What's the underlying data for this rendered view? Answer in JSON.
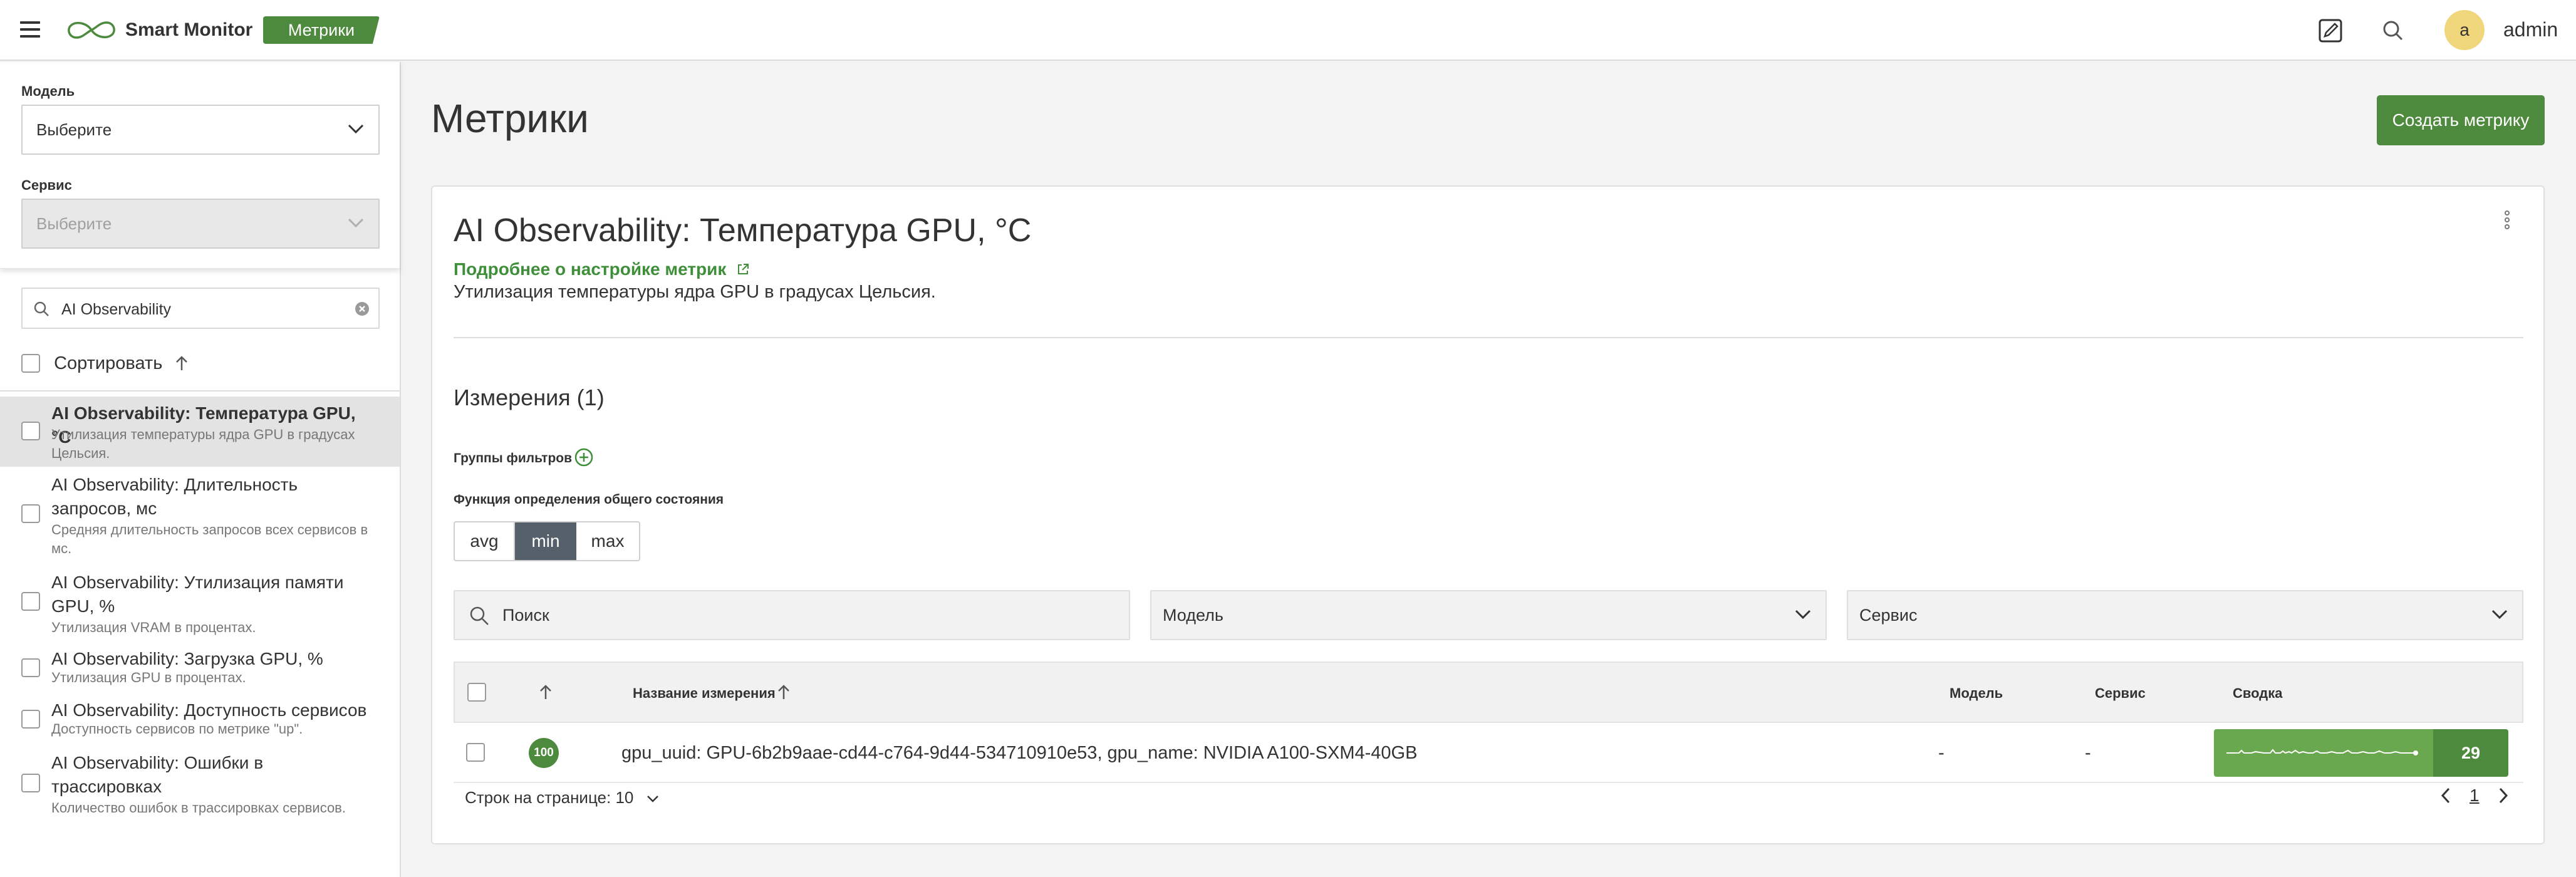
{
  "topbar": {
    "app_name": "Smart Monitor",
    "section": "Метрики",
    "avatar_letter": "a",
    "username": "admin"
  },
  "sidebar": {
    "model_label": "Модель",
    "model_value": "Выберите",
    "service_label": "Сервис",
    "service_value": "Выберите",
    "search_value": "AI Observability",
    "sort_label": "Сортировать",
    "items": [
      {
        "title": "AI Observability: Температура GPU, °C",
        "desc": "Утилизация температуры ядра GPU в градусах Цельсия."
      },
      {
        "title": "AI Observability: Длительность запросов, мс",
        "desc": "Средняя длительность запросов всех сервисов в мс."
      },
      {
        "title": "AI Observability: Утилизация памяти GPU, %",
        "desc": "Утилизация VRAM в процентах."
      },
      {
        "title": "AI Observability: Загрузка GPU, %",
        "desc": "Утилизация GPU в процентах."
      },
      {
        "title": "AI Observability: Доступность сервисов",
        "desc": "Доступность сервисов по метрике \"up\"."
      },
      {
        "title": "AI Observability: Ошибки в трассировках",
        "desc": "Количество ошибок в трассировках сервисов."
      }
    ]
  },
  "main": {
    "page_title": "Метрики",
    "create_button": "Создать метрику",
    "card": {
      "title": "AI Observability: Температура GPU, °C",
      "doc_link": "Подробнее о настройке метрик",
      "description": "Утилизация температуры ядра GPU в градусах Цельсия.",
      "dimensions_title": "Измерения (1)",
      "filter_groups_label": "Группы фильтров",
      "health_function_label": "Функция определения общего состояния",
      "functions": [
        "avg",
        "min",
        "max"
      ],
      "selected_function": "min",
      "search_placeholder": "Поиск",
      "model_filter": "Модель",
      "service_filter": "Сервис",
      "table": {
        "headers": {
          "name": "Название измерения",
          "model": "Модель",
          "service": "Сервис",
          "summary": "Сводка"
        },
        "rows": [
          {
            "status": "100",
            "name": "gpu_uuid: GPU-6b2b9aae-cd44-c764-9d44-534710910e53, gpu_name: NVIDIA A100-SXM4-40GB",
            "model": "-",
            "service": "-",
            "summary_value": "29"
          }
        ]
      },
      "rows_per_page_label": "Строк на странице: 10",
      "current_page": "1"
    }
  },
  "colors": {
    "accent": "#4e8a3e",
    "link": "#3f8f3a",
    "selected_segment": "#56606b"
  }
}
